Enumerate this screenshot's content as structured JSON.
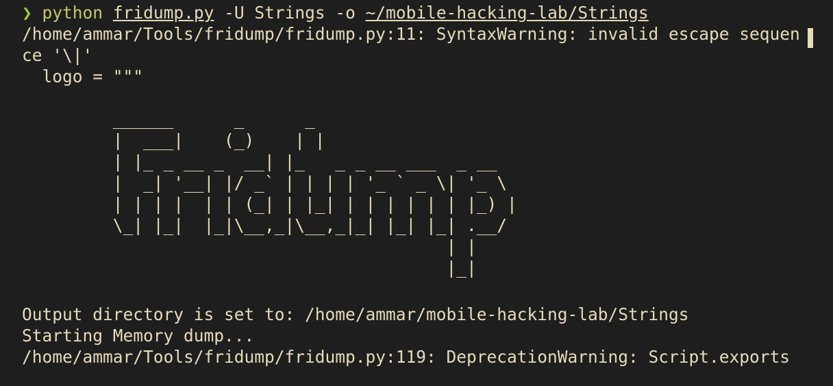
{
  "terminal": {
    "prompt_symbol": "❯",
    "command_program": "python",
    "command_script": "fridump.py",
    "command_args": " -U Strings -o ",
    "command_output_path": "~/mobile-hacking-lab/Strings",
    "syntax_warning_line1": "/home/ammar/Tools/fridump/fridump.py:11: SyntaxWarning: invalid escape sequen",
    "syntax_warning_line2": "ce '\\|'",
    "logo_line": "  logo = \"\"\"",
    "ascii_logo": " ______      _      _\n |  ___|    (_)    | |\n | |_ _ __ _  __| |_   _ _ __ ___  _ __\n |  _| '__| |/ _` | | | | '_ ` _ \\| '_ \\\n | | | |  | | (_| | |_| | | | | | | |_) |\n \\_| |_|  |_|\\__,_|\\__,_|_| |_| |_| .__/\n                                  | |\n                                  |_|",
    "output_dir_line": "Output directory is set to: /home/ammar/mobile-hacking-lab/Strings",
    "starting_line": "Starting Memory dump...",
    "deprecation_line": "/home/ammar/Tools/fridump/fridump.py:119: DeprecationWarning: Script.exports"
  },
  "colors": {
    "background": "#1e1e1e",
    "text": "#e6dbb9",
    "prompt_arrow": "#a4c639",
    "command": "#c5c86a"
  }
}
